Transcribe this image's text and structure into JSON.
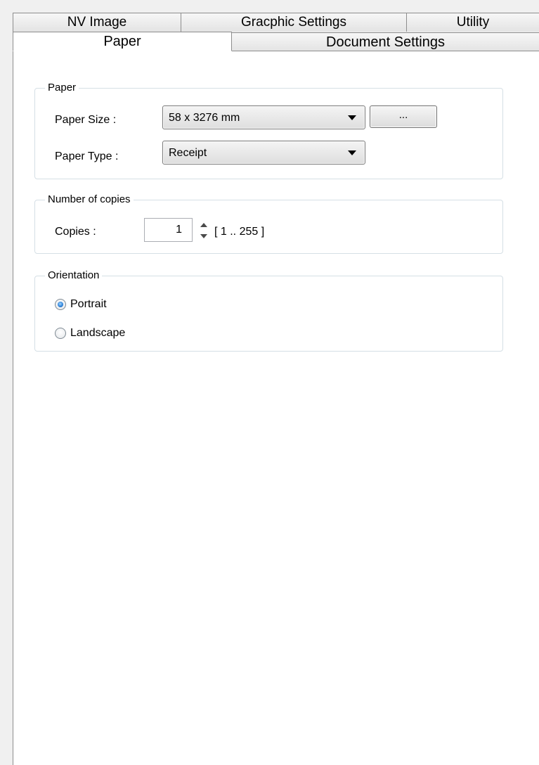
{
  "tabs": {
    "row1": [
      {
        "label": "NV Image"
      },
      {
        "label": "Gracphic Settings"
      },
      {
        "label": "Utility"
      }
    ],
    "row2": [
      {
        "label": "Paper",
        "active": true
      },
      {
        "label": "Document Settings"
      }
    ]
  },
  "paper_group": {
    "title": "Paper",
    "size_label": "Paper Size :",
    "size_value": "58 x 3276 mm",
    "browse_label": "...",
    "type_label": "Paper Type :",
    "type_value": "Receipt"
  },
  "copies_group": {
    "title": "Number of copies",
    "copies_label": "Copies :",
    "copies_value": "1",
    "range_text": "[ 1 .. 255 ]"
  },
  "orientation_group": {
    "title": "Orientation",
    "options": [
      {
        "label": "Portrait",
        "checked": true
      },
      {
        "label": "Landscape",
        "checked": false
      }
    ]
  }
}
